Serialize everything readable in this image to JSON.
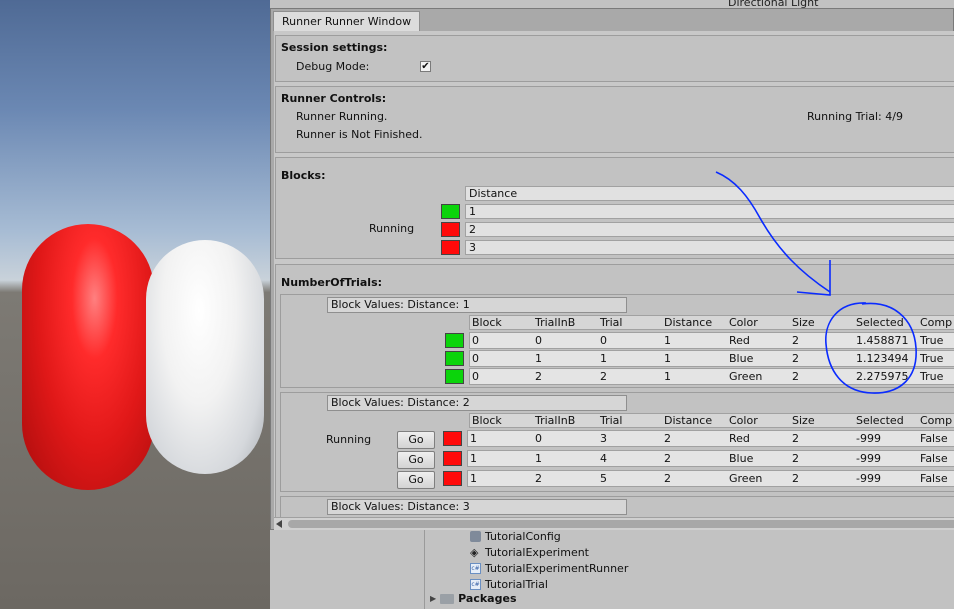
{
  "window": {
    "tab_title": "Runner Runner Window"
  },
  "hierarchy_top": "Directional Light",
  "session": {
    "header": "Session settings:",
    "debug_label": "Debug Mode:",
    "debug_checked": "✔"
  },
  "runner": {
    "header": "Runner Controls:",
    "status1": "Runner Running.",
    "status2": "Runner is Not Finished.",
    "trial": "Running Trial: 4/9"
  },
  "blocks": {
    "header": "Blocks:",
    "column": "Distance",
    "running_label": "Running",
    "rows": [
      {
        "value": "1",
        "color": "green"
      },
      {
        "value": "2",
        "color": "red"
      },
      {
        "value": "3",
        "color": "red"
      }
    ]
  },
  "trials": {
    "header": "NumberOfTrials:",
    "columns": [
      "Block",
      "TrialInB",
      "Trial",
      "Distance",
      "Color",
      "Size",
      "Selected",
      "Comp"
    ],
    "go_label": "Go",
    "groups": [
      {
        "title": "Block Values: Distance: 1",
        "status": "",
        "rows": [
          [
            "0",
            "0",
            "0",
            "1",
            "Red",
            "2",
            "1.458871",
            "True"
          ],
          [
            "0",
            "1",
            "1",
            "1",
            "Blue",
            "2",
            "1.123494",
            "True"
          ],
          [
            "0",
            "2",
            "2",
            "1",
            "Green",
            "2",
            "2.275975",
            "True"
          ]
        ],
        "row_colors": [
          "green",
          "green",
          "green"
        ]
      },
      {
        "title": "Block Values: Distance: 2",
        "status": "Running",
        "rows": [
          [
            "1",
            "0",
            "3",
            "2",
            "Red",
            "2",
            "-999",
            "False"
          ],
          [
            "1",
            "1",
            "4",
            "2",
            "Blue",
            "2",
            "-999",
            "False"
          ],
          [
            "1",
            "2",
            "5",
            "2",
            "Green",
            "2",
            "-999",
            "False"
          ]
        ],
        "row_colors": [
          "red",
          "red",
          "red"
        ]
      },
      {
        "title": "Block Values: Distance: 3"
      }
    ]
  },
  "project": {
    "items": [
      {
        "label": "TutorialConfig",
        "icon": "config-icon"
      },
      {
        "label": "TutorialExperiment",
        "icon": "unity-icon"
      },
      {
        "label": "TutorialExperimentRunner",
        "icon": "csharp-script-icon"
      },
      {
        "label": "TutorialTrial",
        "icon": "csharp-script-icon"
      }
    ],
    "packages": "Packages"
  },
  "colors": {
    "green": "#0bd40b",
    "red": "#ff0a0a",
    "annotation": "#0a2bff"
  }
}
